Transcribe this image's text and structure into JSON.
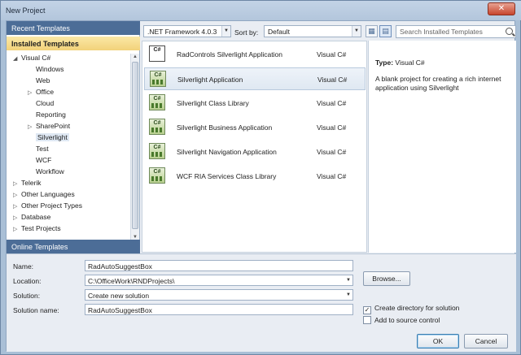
{
  "window": {
    "title": "New Project",
    "close_label": "✕"
  },
  "left": {
    "recent_label": "Recent Templates",
    "installed_label": "Installed Templates",
    "online_label": "Online Templates",
    "tree": [
      {
        "label": "Visual C#",
        "arrow": "◢",
        "indent": 0,
        "selected": false
      },
      {
        "label": "Windows",
        "arrow": "",
        "indent": 1,
        "selected": false
      },
      {
        "label": "Web",
        "arrow": "",
        "indent": 1,
        "selected": false
      },
      {
        "label": "Office",
        "arrow": "▷",
        "indent": 1,
        "selected": false
      },
      {
        "label": "Cloud",
        "arrow": "",
        "indent": 1,
        "selected": false
      },
      {
        "label": "Reporting",
        "arrow": "",
        "indent": 1,
        "selected": false
      },
      {
        "label": "SharePoint",
        "arrow": "▷",
        "indent": 1,
        "selected": false
      },
      {
        "label": "Silverlight",
        "arrow": "",
        "indent": 1,
        "selected": true
      },
      {
        "label": "Test",
        "arrow": "",
        "indent": 1,
        "selected": false
      },
      {
        "label": "WCF",
        "arrow": "",
        "indent": 1,
        "selected": false
      },
      {
        "label": "Workflow",
        "arrow": "",
        "indent": 1,
        "selected": false
      },
      {
        "label": "Telerik",
        "arrow": "▷",
        "indent": 0,
        "selected": false
      },
      {
        "label": "Other Languages",
        "arrow": "▷",
        "indent": 0,
        "selected": false
      },
      {
        "label": "Other Project Types",
        "arrow": "▷",
        "indent": 0,
        "selected": false
      },
      {
        "label": "Database",
        "arrow": "▷",
        "indent": 0,
        "selected": false
      },
      {
        "label": "Test Projects",
        "arrow": "▷",
        "indent": 0,
        "selected": false
      }
    ]
  },
  "toolbar": {
    "framework": ".NET Framework 4.0.3",
    "sortby_label": "Sort by:",
    "sortby_value": "Default",
    "search_placeholder": "Search Installed Templates"
  },
  "templates": [
    {
      "name": "RadControls Silverlight Application",
      "lang": "Visual C#",
      "selected": false,
      "icon": "csharp-file-icon"
    },
    {
      "name": "Silverlight Application",
      "lang": "Visual C#",
      "selected": true,
      "icon": "silverlight-app-icon"
    },
    {
      "name": "Silverlight Class Library",
      "lang": "Visual C#",
      "selected": false,
      "icon": "class-library-icon"
    },
    {
      "name": "Silverlight Business Application",
      "lang": "Visual C#",
      "selected": false,
      "icon": "business-app-icon"
    },
    {
      "name": "Silverlight Navigation Application",
      "lang": "Visual C#",
      "selected": false,
      "icon": "navigation-app-icon"
    },
    {
      "name": "WCF RIA Services Class Library",
      "lang": "Visual C#",
      "selected": false,
      "icon": "ria-library-icon"
    }
  ],
  "description": {
    "type_label": "Type:",
    "type_value": "Visual C#",
    "text": "A blank project for creating a rich internet application using Silverlight"
  },
  "form": {
    "name_label": "Name:",
    "name_value": "RadAutoSuggestBox",
    "location_label": "Location:",
    "location_value": "C:\\OfficeWork\\RNDProjects\\",
    "solution_label": "Solution:",
    "solution_value": "Create new solution",
    "solution_name_label": "Solution name:",
    "solution_name_value": "RadAutoSuggestBox",
    "browse_label": "Browse...",
    "create_dir_label": "Create directory for solution",
    "create_dir_checked": true,
    "source_control_label": "Add to source control",
    "source_control_checked": false,
    "ok_label": "OK",
    "cancel_label": "Cancel"
  }
}
